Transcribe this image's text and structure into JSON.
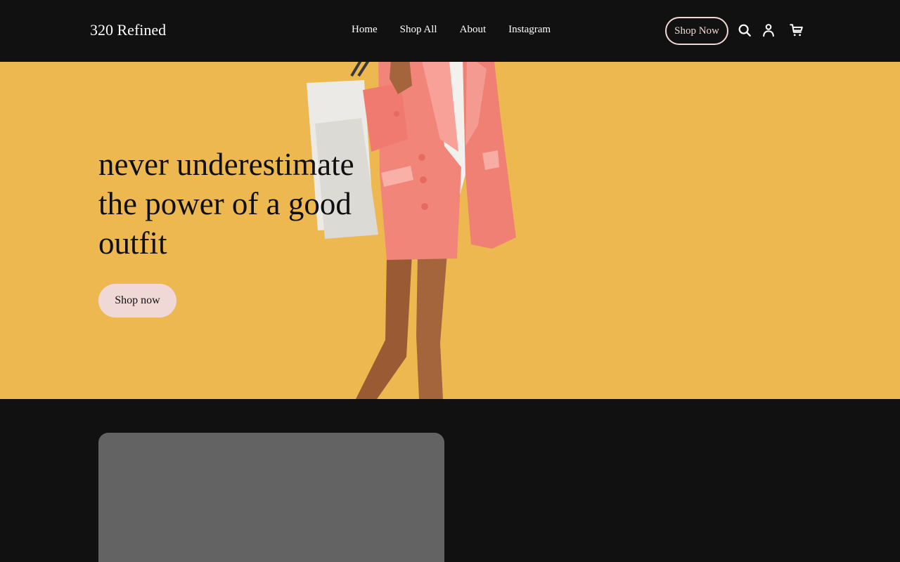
{
  "header": {
    "brand": "320 Refined",
    "nav": [
      {
        "label": "Home"
      },
      {
        "label": "Shop All"
      },
      {
        "label": "About"
      },
      {
        "label": "Instagram"
      }
    ],
    "cta_label": "Shop Now",
    "icons": [
      "search-icon",
      "account-icon",
      "cart-icon"
    ]
  },
  "hero": {
    "headline": "never underestimate the power of a good outfit",
    "button_label": "Shop now",
    "background_color": "#edb850",
    "image": "woman in pink blazer carrying shopping bags"
  },
  "colors": {
    "page_bg": "#111111",
    "accent": "#f0d8d6",
    "card_placeholder": "#636363"
  }
}
